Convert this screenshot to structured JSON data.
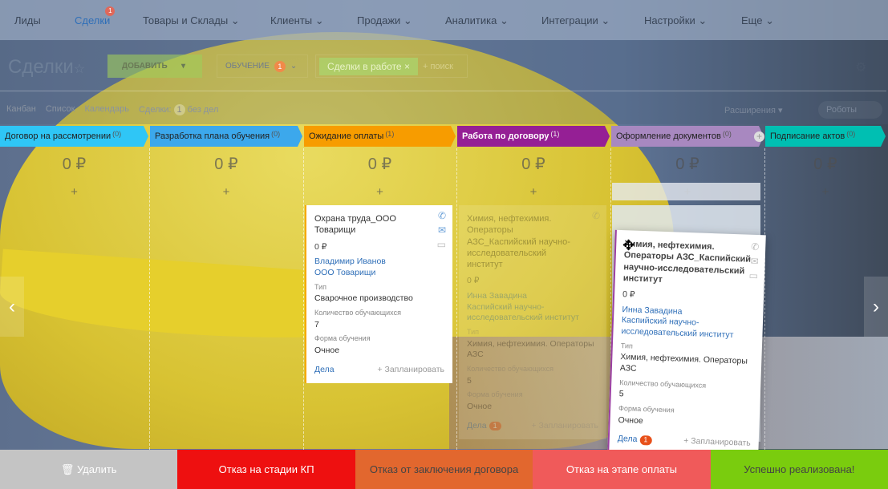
{
  "nav": {
    "items": [
      {
        "label": "Лиды"
      },
      {
        "label": "Сделки",
        "badge": "1",
        "active": true
      },
      {
        "label": "Товары и Склады ⌄"
      },
      {
        "label": "Клиенты ⌄"
      },
      {
        "label": "Продажи ⌄"
      },
      {
        "label": "Аналитика ⌄"
      },
      {
        "label": "Интеграции ⌄"
      },
      {
        "label": "Настройки ⌄"
      },
      {
        "label": "Еще ⌄"
      }
    ]
  },
  "header": {
    "title": "Сделки",
    "star": "☆",
    "add_label": "ДОБАВИТЬ",
    "add_caret": "▾",
    "filter_label": "ОБУЧЕНИЕ",
    "filter_badge": "1",
    "filter_caret": "⌄",
    "search_tag": "Сделки в работе",
    "search_tag_close": "×",
    "search_placeholder": "+ поиск",
    "gear": "⚙"
  },
  "views": {
    "kanban": "Канбан",
    "list": "Список",
    "calendar": "Календарь",
    "deals_label": "Сделки:",
    "deals_count": "1",
    "no_tasks": "без дел",
    "extensions": "Расширения ▾",
    "robots": "Роботы"
  },
  "columns": [
    {
      "name": "Договор на рассмотрении",
      "count": "(0)",
      "sum": "0 ₽",
      "color": "#2fc6f6"
    },
    {
      "name": "Разработка плана обучения",
      "count": "(0)",
      "sum": "0 ₽",
      "color": "#3ca8ec"
    },
    {
      "name": "Ожидание оплаты",
      "count": "(1)",
      "sum": "0 ₽",
      "color": "#f79c00"
    },
    {
      "name": "Работа по договору",
      "count": "(1)",
      "sum": "0 ₽",
      "color": "#951f95"
    },
    {
      "name": "Оформление документов",
      "count": "(0)",
      "sum": "0 ₽",
      "color": "#a888c0"
    },
    {
      "name": "Подписание актов",
      "count": "(0)",
      "sum": "0 ₽",
      "color": "#00bfb2"
    }
  ],
  "add_symbol": "+",
  "cards": [
    {
      "title": "Охрана труда_ООО Товарищи",
      "amount": "0 ₽",
      "contact": "Владимир Иванов",
      "company": "ООО Товарищи",
      "type_label": "Тип",
      "type": "Сварочное производство",
      "qty_label": "Количество обучающихся",
      "qty": "7",
      "form_label": "Форма обучения",
      "form": "Очное",
      "tasks": "Дела",
      "plan": "+ Запланировать"
    },
    {
      "title": "Химия, нефтехимия. Операторы АЗС_Каспийский научно-исследовательский институт",
      "amount": "0 ₽",
      "contact": "Инна Завадина",
      "company": "Каспийский научно-исследовательский институт",
      "type_label": "Тип",
      "type": "Химия, нефтехимия. Операторы АЗС",
      "qty_label": "Количество обучающихся",
      "qty": "5",
      "form_label": "Форма обучения",
      "form": "Очное",
      "tasks": "Дела",
      "tasks_badge": "1",
      "plan": "+ Запланировать"
    }
  ],
  "bottom": [
    {
      "label": "🗑 Удалить",
      "color": "#c4c4c4",
      "text": "#fff"
    },
    {
      "label": "Отказ на стадии КП",
      "color": "#ee1010",
      "text": "#fff"
    },
    {
      "label": "Отказ от заключения договора",
      "color": "#e2672e",
      "text": "#444"
    },
    {
      "label": "Отказ на этапе оплаты",
      "color": "#f05a5a",
      "text": "#fff"
    },
    {
      "label": "Успешно реализована!",
      "color": "#7acc0e",
      "text": "#444"
    }
  ]
}
